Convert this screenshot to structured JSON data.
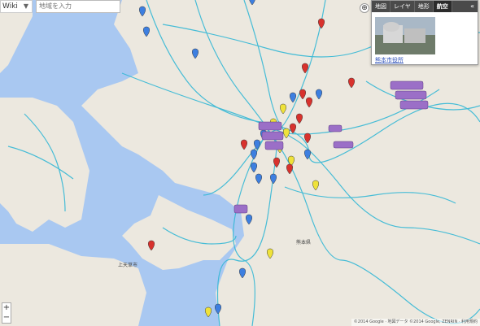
{
  "controls": {
    "map_type_label": "Wiki",
    "search_placeholder": "地域を入力",
    "locate_glyph": "⊕",
    "zoom_in": "+",
    "zoom_out": "−"
  },
  "panel": {
    "tabs": [
      "地図",
      "レイヤ",
      "地形",
      "航空"
    ],
    "active_tab": 3,
    "collapse_glyph": "«",
    "photo_caption": "熊本市役所"
  },
  "labels": {
    "kumamoto": "熊本県",
    "amakusa": "上天草市"
  },
  "attribution": "©2014 Google · 地図データ ©2014 Google, ZENRIN · 利用規約",
  "colors": {
    "water": "#a9c8f1",
    "land": "#ece8df",
    "roads": "#35b8d6",
    "pin_blue": "#3d7fe0",
    "pin_red": "#d8322d",
    "pin_yellow": "#efe23a",
    "photo_marker": "#9b6fc7"
  },
  "markers": [
    {
      "color": "blue"
    },
    {
      "color": "blue"
    },
    {
      "color": "blue"
    },
    {
      "color": "blue"
    },
    {
      "color": "red"
    },
    {
      "color": "red"
    },
    {
      "color": "yellow"
    },
    {
      "color": "blue"
    },
    {
      "color": "red"
    },
    {
      "color": "red"
    },
    {
      "color": "blue"
    },
    {
      "color": "yellow"
    },
    {
      "color": "red"
    },
    {
      "color": "red"
    },
    {
      "color": "blue"
    },
    {
      "color": "yellow"
    },
    {
      "color": "red"
    },
    {
      "color": "blue"
    },
    {
      "color": "yellow"
    },
    {
      "color": "blue"
    },
    {
      "color": "red"
    },
    {
      "color": "red"
    },
    {
      "color": "yellow"
    },
    {
      "color": "blue"
    },
    {
      "color": "blue"
    },
    {
      "color": "red"
    },
    {
      "color": "yellow"
    },
    {
      "color": "blue"
    },
    {
      "color": "blue"
    },
    {
      "color": "yellow"
    },
    {
      "color": "blue"
    },
    {
      "color": "red"
    },
    {
      "color": "red"
    },
    {
      "color": "blue"
    },
    {
      "color": "yellow"
    },
    {
      "color": "blue"
    }
  ]
}
